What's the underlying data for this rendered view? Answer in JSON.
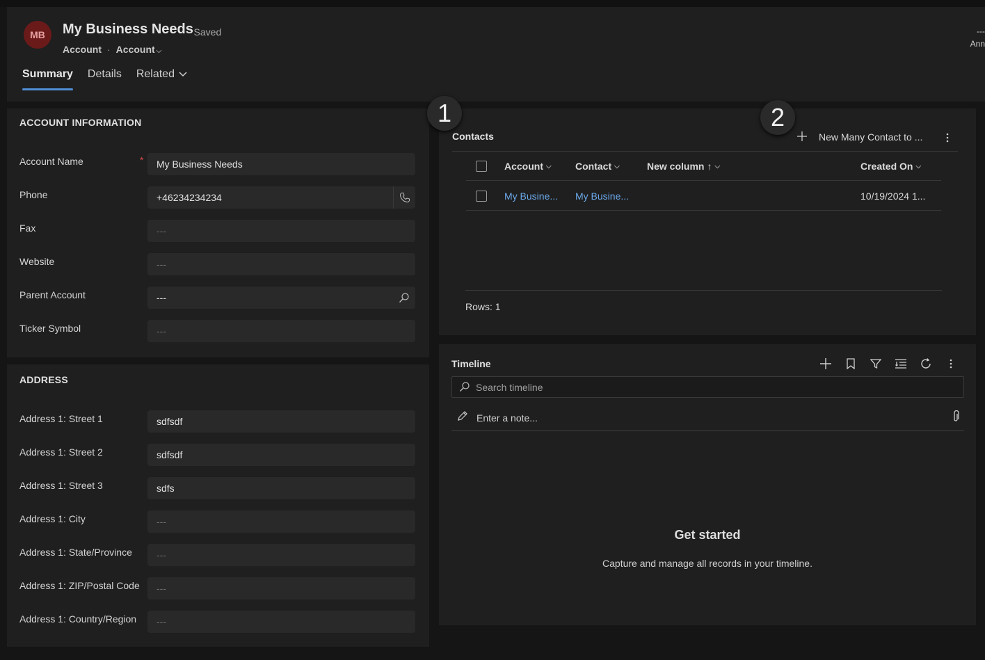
{
  "header": {
    "avatar_initials": "MB",
    "title": "My Business Needs",
    "saved_status": "- Saved",
    "breadcrumb": [
      "Account",
      "Account"
    ],
    "right_meta_value": "---",
    "right_meta_label": "Ann"
  },
  "tabs": [
    {
      "label": "Summary",
      "active": true
    },
    {
      "label": "Details",
      "active": false
    },
    {
      "label": "Related",
      "active": false
    }
  ],
  "account_info": {
    "title": "ACCOUNT INFORMATION",
    "fields": [
      {
        "label": "Account Name",
        "value": "My Business Needs",
        "required": true
      },
      {
        "label": "Phone",
        "value": "+46234234234"
      },
      {
        "label": "Fax",
        "value": "---"
      },
      {
        "label": "Website",
        "value": "---"
      },
      {
        "label": "Parent Account",
        "value": "---"
      },
      {
        "label": "Ticker Symbol",
        "value": "---"
      }
    ]
  },
  "address": {
    "title": "ADDRESS",
    "fields": [
      {
        "label": "Address 1: Street 1",
        "value": "sdfsdf"
      },
      {
        "label": "Address 1: Street 2",
        "value": "sdfsdf"
      },
      {
        "label": "Address 1: Street 3",
        "value": "sdfs"
      },
      {
        "label": "Address 1: City",
        "value": "---"
      },
      {
        "label": "Address 1: State/Province",
        "value": "---"
      },
      {
        "label": "Address 1: ZIP/Postal Code",
        "value": "---"
      },
      {
        "label": "Address 1: Country/Region",
        "value": "---"
      }
    ]
  },
  "contacts": {
    "title": "Contacts",
    "badge_1": "1",
    "badge_2": "2",
    "new_button": "New Many Contact to ...",
    "columns": [
      "Account",
      "Contact",
      "New column",
      "Created On"
    ],
    "rows": [
      {
        "account": "My Busine...",
        "contact": "My Busine...",
        "new_column": "",
        "created_on": "10/19/2024 1..."
      }
    ],
    "rows_count": "Rows: 1"
  },
  "timeline": {
    "title": "Timeline",
    "search_placeholder": "Search timeline",
    "note_placeholder": "Enter a note...",
    "empty_title": "Get started",
    "empty_subtitle": "Capture and manage all records in your timeline."
  },
  "colors": {
    "accent": "#4f8fd6",
    "link": "#6aa7e8",
    "avatar_bg": "#6b1a1a",
    "required": "#d44a4a"
  }
}
